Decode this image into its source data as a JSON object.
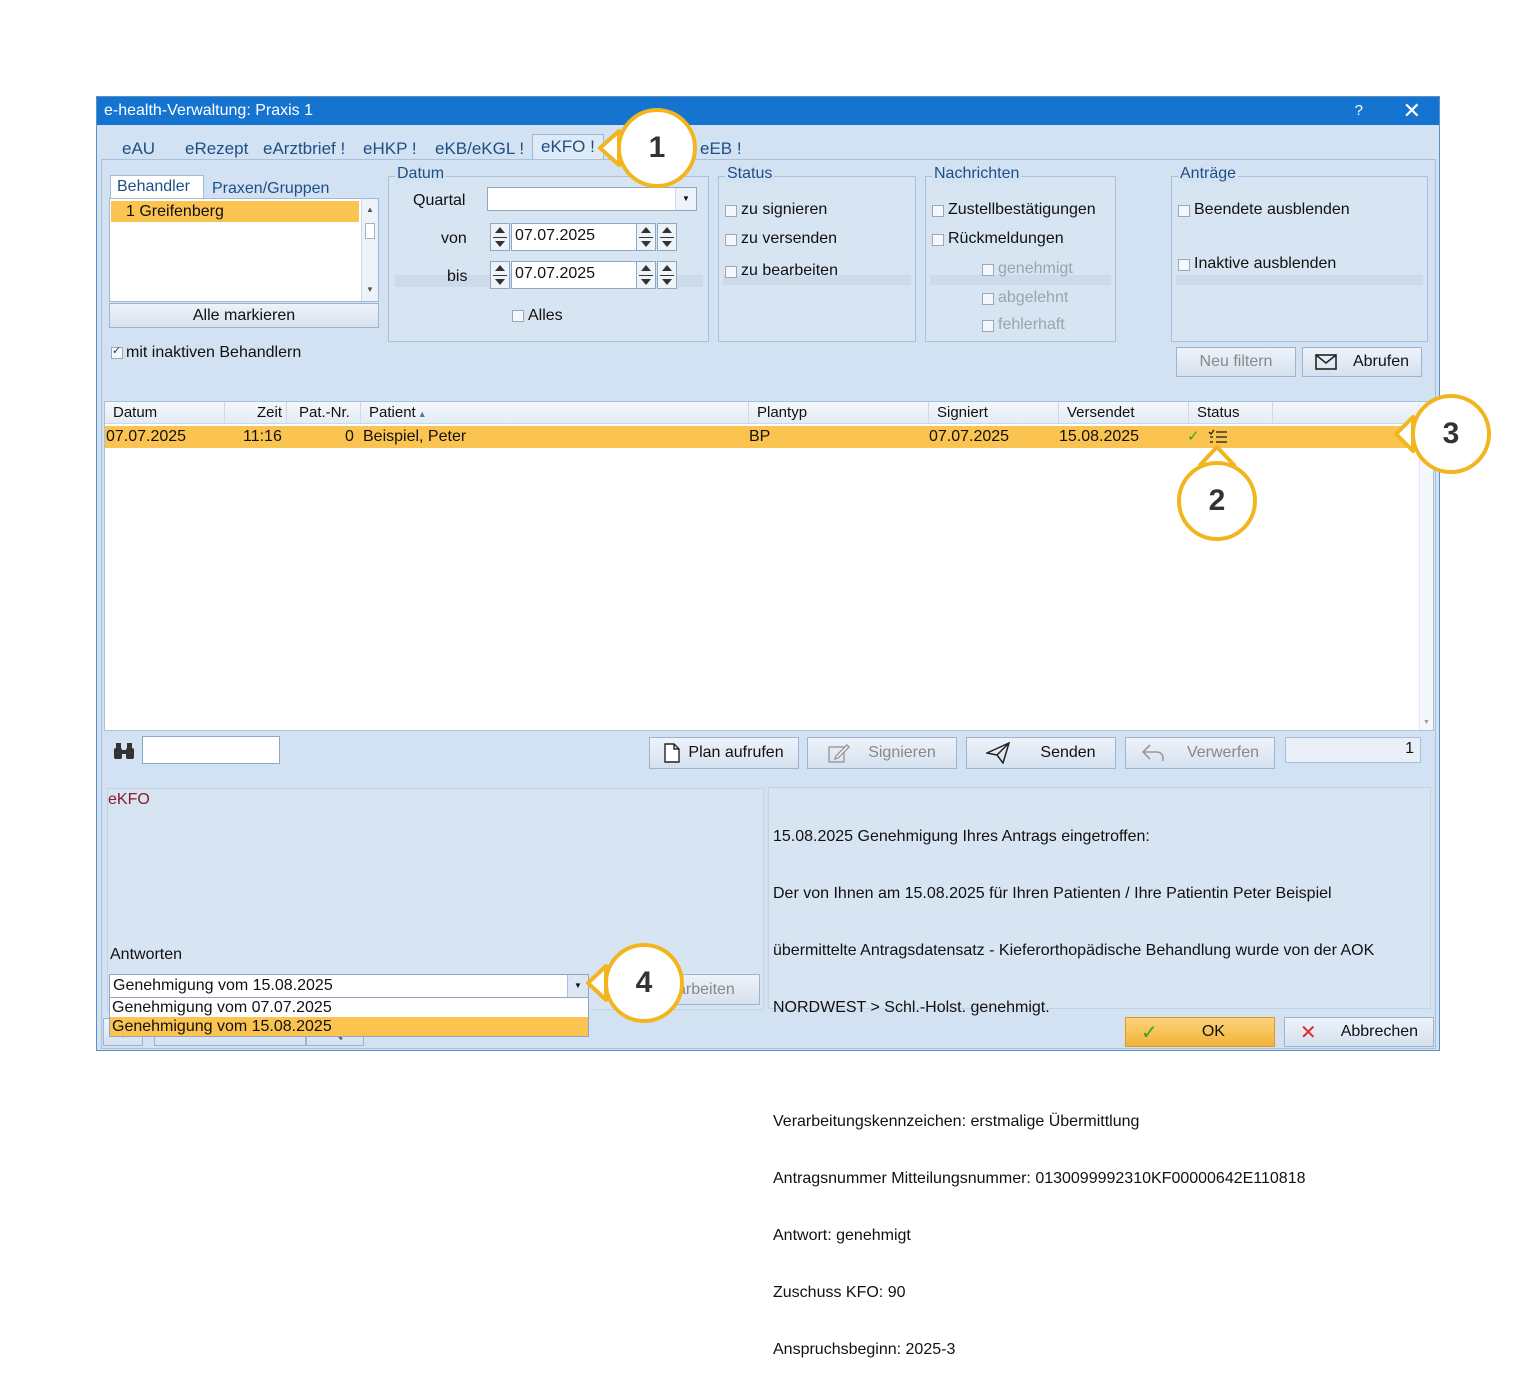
{
  "window": {
    "title": "e-health-Verwaltung: Praxis 1",
    "help": "?",
    "close": "✕"
  },
  "tabs": [
    "eAU",
    "eRezept",
    "eArztbrief !",
    "eHKP !",
    "eKB/eKGL !",
    "eKFO !",
    "eEB !"
  ],
  "behandler": {
    "tab_active": "Behandler",
    "tab_other": "Praxen/Gruppen",
    "items": [
      "1 Greifenberg"
    ],
    "mark_all": "Alle markieren",
    "inactive_label": "mit inaktiven Behandlern",
    "inactive_checked": true
  },
  "datum": {
    "title": "Datum",
    "quartal_label": "Quartal",
    "quartal_value": "",
    "von_label": "von",
    "von_value": "07.07.2025",
    "bis_label": "bis",
    "bis_value": "07.07.2025",
    "alles_label": "Alles"
  },
  "status": {
    "title": "Status",
    "items": [
      "zu signieren",
      "zu versenden",
      "zu bearbeiten"
    ]
  },
  "nachrichten": {
    "title": "Nachrichten",
    "items": [
      "Zustellbestätigungen",
      "Rückmeldungen"
    ],
    "sub_items": [
      "genehmigt",
      "abgelehnt",
      "fehlerhaft"
    ]
  },
  "antraege": {
    "title": "Anträge",
    "items": [
      "Beendete ausblenden",
      "Inaktive ausblenden"
    ]
  },
  "buttons": {
    "neu_filtern": "Neu filtern",
    "abrufen": "Abrufen",
    "plan_aufrufen": "Plan aufrufen",
    "signieren": "Signieren",
    "senden": "Senden",
    "verwerfen": "Verwerfen",
    "bearbeiten_partial": "arbeiten",
    "ok": "OK",
    "abbrechen": "Abbrechen"
  },
  "table": {
    "headers": [
      "Datum",
      "Zeit",
      "Pat.-Nr.",
      "Patient",
      "Plantyp",
      "Signiert",
      "Versendet",
      "Status"
    ],
    "rows": [
      {
        "datum": "07.07.2025",
        "zeit": "11:16",
        "patnr": "0",
        "patient": "Beispiel, Peter",
        "plantyp": "BP",
        "signiert": "07.07.2025",
        "versendet": "15.08.2025"
      }
    ]
  },
  "count": "1",
  "detail": {
    "left_title": "eKFO",
    "antworten_label": "Antworten",
    "antworten_selected": "Genehmigung vom 15.08.2025",
    "antworten_options": [
      "Genehmigung vom 07.07.2025",
      "Genehmigung vom 15.08.2025"
    ],
    "message_lines": [
      "15.08.2025 Genehmigung Ihres Antrags eingetroffen:",
      "Der von Ihnen am 15.08.2025 für Ihren Patienten / Ihre Patientin Peter Beispiel",
      "übermittelte Antragsdatensatz - Kieferorthopädische Behandlung wurde von der AOK",
      "NORDWEST > Schl.-Holst. genehmigt.",
      "",
      "Verarbeitungskennzeichen: erstmalige Übermittlung",
      "Antragsnummer Mitteilungsnummer: 0130099992310KF00000642E110818",
      "Antwort: genehmigt",
      "Zuschuss KFO: 90",
      "Anspruchsbeginn: 2025-3"
    ]
  },
  "callouts": [
    "1",
    "2",
    "3",
    "4"
  ],
  "colors": {
    "title_bar": "#1574d0",
    "selection": "#fbc451",
    "callout": "#f2b51d",
    "check": "#3aa51f",
    "cancel": "#d92b2b"
  }
}
